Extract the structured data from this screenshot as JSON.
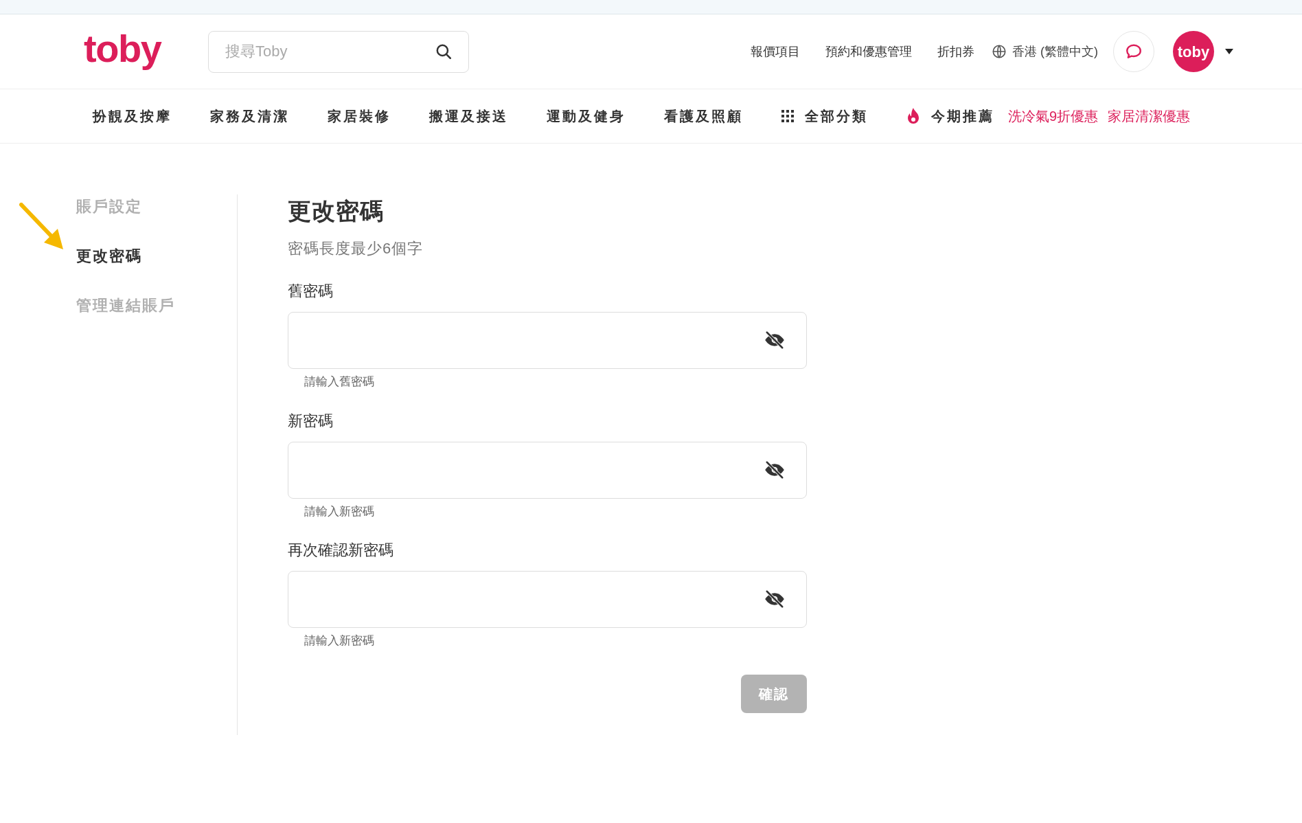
{
  "header": {
    "logo": "toby",
    "search": {
      "placeholder": "搜尋Toby"
    },
    "links": [
      "報價項目",
      "預約和優惠管理",
      "折扣券"
    ],
    "language": "香港 (繁體中文)",
    "avatar": "toby"
  },
  "categories": [
    {
      "label": "扮靚及按摩",
      "kind": "plain"
    },
    {
      "label": "家務及清潔",
      "kind": "plain"
    },
    {
      "label": "家居裝修",
      "kind": "plain"
    },
    {
      "label": "搬運及接送",
      "kind": "plain"
    },
    {
      "label": "運動及健身",
      "kind": "plain"
    },
    {
      "label": "看護及照顧",
      "kind": "plain"
    },
    {
      "label": "全部分類",
      "kind": "grid"
    },
    {
      "label": "今期推薦",
      "kind": "hot"
    }
  ],
  "promos": [
    "洗冷氣9折優惠",
    "家居清潔優惠"
  ],
  "sidebar": {
    "items": [
      {
        "label": "賬戶設定",
        "selected": false
      },
      {
        "label": "更改密碼",
        "selected": true
      },
      {
        "label": "管理連結賬戶",
        "selected": false
      }
    ]
  },
  "form": {
    "title": "更改密碼",
    "subtitle": "密碼長度最少6個字",
    "fields": [
      {
        "label": "舊密碼",
        "hint": "請輸入舊密碼"
      },
      {
        "label": "新密碼",
        "hint": "請輸入新密碼"
      },
      {
        "label": "再次確認新密碼",
        "hint": "請輸入新密碼"
      }
    ],
    "submit": {
      "label": "確認",
      "disabled": true
    }
  }
}
